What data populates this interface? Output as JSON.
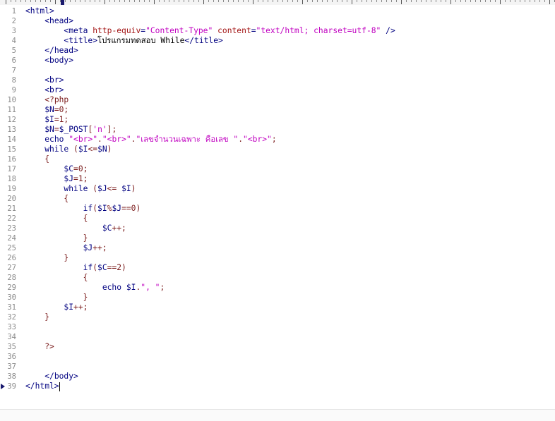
{
  "editor": {
    "lines": [
      {
        "n": "1",
        "segs": [
          {
            "c": "tag",
            "t": "<html>"
          }
        ]
      },
      {
        "n": "2",
        "segs": [
          {
            "c": "plain",
            "t": "    "
          },
          {
            "c": "tag",
            "t": "<head>"
          }
        ]
      },
      {
        "n": "3",
        "segs": [
          {
            "c": "plain",
            "t": "        "
          },
          {
            "c": "tag",
            "t": "<meta "
          },
          {
            "c": "attr",
            "t": "http-equiv"
          },
          {
            "c": "tag",
            "t": "="
          },
          {
            "c": "str",
            "t": "\"Content-Type\""
          },
          {
            "c": "tag",
            "t": " "
          },
          {
            "c": "attr",
            "t": "content"
          },
          {
            "c": "tag",
            "t": "="
          },
          {
            "c": "str",
            "t": "\"text/html; charset=utf-8\""
          },
          {
            "c": "tag",
            "t": " />"
          }
        ]
      },
      {
        "n": "4",
        "segs": [
          {
            "c": "plain",
            "t": "        "
          },
          {
            "c": "tag",
            "t": "<title>"
          },
          {
            "c": "plain",
            "t": "โปรแกรมทดสอบ While"
          },
          {
            "c": "tag",
            "t": "</title>"
          }
        ]
      },
      {
        "n": "5",
        "segs": [
          {
            "c": "plain",
            "t": "    "
          },
          {
            "c": "tag",
            "t": "</head>"
          }
        ]
      },
      {
        "n": "6",
        "segs": [
          {
            "c": "plain",
            "t": "    "
          },
          {
            "c": "tag",
            "t": "<body>"
          }
        ]
      },
      {
        "n": "7",
        "segs": []
      },
      {
        "n": "8",
        "segs": [
          {
            "c": "plain",
            "t": "    "
          },
          {
            "c": "tag",
            "t": "<br>"
          }
        ]
      },
      {
        "n": "9",
        "segs": [
          {
            "c": "plain",
            "t": "    "
          },
          {
            "c": "tag",
            "t": "<br>"
          }
        ]
      },
      {
        "n": "10",
        "segs": [
          {
            "c": "plain",
            "t": "    "
          },
          {
            "c": "php",
            "t": "<?php"
          }
        ]
      },
      {
        "n": "11",
        "segs": [
          {
            "c": "plain",
            "t": "    "
          },
          {
            "c": "var",
            "t": "$N"
          },
          {
            "c": "php",
            "t": "=0;"
          }
        ]
      },
      {
        "n": "12",
        "segs": [
          {
            "c": "plain",
            "t": "    "
          },
          {
            "c": "var",
            "t": "$I"
          },
          {
            "c": "php",
            "t": "=1;"
          }
        ]
      },
      {
        "n": "13",
        "segs": [
          {
            "c": "plain",
            "t": "    "
          },
          {
            "c": "var",
            "t": "$N"
          },
          {
            "c": "php",
            "t": "="
          },
          {
            "c": "var",
            "t": "$_POST"
          },
          {
            "c": "php",
            "t": "["
          },
          {
            "c": "str",
            "t": "'n'"
          },
          {
            "c": "php",
            "t": "];"
          }
        ]
      },
      {
        "n": "14",
        "segs": [
          {
            "c": "plain",
            "t": "    "
          },
          {
            "c": "kw",
            "t": "echo "
          },
          {
            "c": "str",
            "t": "\"<br>\""
          },
          {
            "c": "php",
            "t": "."
          },
          {
            "c": "str",
            "t": "\"<br>\""
          },
          {
            "c": "php",
            "t": "."
          },
          {
            "c": "str",
            "t": "\"เลขจำนวนเฉพาะ คือเลข \""
          },
          {
            "c": "php",
            "t": "."
          },
          {
            "c": "str",
            "t": "\"<br>\""
          },
          {
            "c": "php",
            "t": ";"
          }
        ]
      },
      {
        "n": "15",
        "segs": [
          {
            "c": "plain",
            "t": "    "
          },
          {
            "c": "kw",
            "t": "while "
          },
          {
            "c": "php",
            "t": "("
          },
          {
            "c": "var",
            "t": "$I"
          },
          {
            "c": "php",
            "t": "<="
          },
          {
            "c": "var",
            "t": "$N"
          },
          {
            "c": "php",
            "t": ")"
          }
        ]
      },
      {
        "n": "16",
        "segs": [
          {
            "c": "plain",
            "t": "    "
          },
          {
            "c": "php",
            "t": "{"
          }
        ]
      },
      {
        "n": "17",
        "segs": [
          {
            "c": "plain",
            "t": "        "
          },
          {
            "c": "var",
            "t": "$C"
          },
          {
            "c": "php",
            "t": "=0;"
          }
        ]
      },
      {
        "n": "18",
        "segs": [
          {
            "c": "plain",
            "t": "        "
          },
          {
            "c": "var",
            "t": "$J"
          },
          {
            "c": "php",
            "t": "=1;"
          }
        ]
      },
      {
        "n": "19",
        "segs": [
          {
            "c": "plain",
            "t": "        "
          },
          {
            "c": "kw",
            "t": "while "
          },
          {
            "c": "php",
            "t": "("
          },
          {
            "c": "var",
            "t": "$J"
          },
          {
            "c": "php",
            "t": "<= "
          },
          {
            "c": "var",
            "t": "$I"
          },
          {
            "c": "php",
            "t": ")"
          }
        ]
      },
      {
        "n": "20",
        "segs": [
          {
            "c": "plain",
            "t": "        "
          },
          {
            "c": "php",
            "t": "{"
          }
        ]
      },
      {
        "n": "21",
        "segs": [
          {
            "c": "plain",
            "t": "            "
          },
          {
            "c": "kw",
            "t": "if"
          },
          {
            "c": "php",
            "t": "("
          },
          {
            "c": "var",
            "t": "$I"
          },
          {
            "c": "php",
            "t": "%"
          },
          {
            "c": "var",
            "t": "$J"
          },
          {
            "c": "php",
            "t": "==0)"
          }
        ]
      },
      {
        "n": "22",
        "segs": [
          {
            "c": "plain",
            "t": "            "
          },
          {
            "c": "php",
            "t": "{"
          }
        ]
      },
      {
        "n": "23",
        "segs": [
          {
            "c": "plain",
            "t": "                "
          },
          {
            "c": "var",
            "t": "$C"
          },
          {
            "c": "php",
            "t": "++;"
          }
        ]
      },
      {
        "n": "24",
        "segs": [
          {
            "c": "plain",
            "t": "            "
          },
          {
            "c": "php",
            "t": "}"
          }
        ]
      },
      {
        "n": "25",
        "segs": [
          {
            "c": "plain",
            "t": "            "
          },
          {
            "c": "var",
            "t": "$J"
          },
          {
            "c": "php",
            "t": "++;"
          }
        ]
      },
      {
        "n": "26",
        "segs": [
          {
            "c": "plain",
            "t": "        "
          },
          {
            "c": "php",
            "t": "}"
          }
        ]
      },
      {
        "n": "27",
        "segs": [
          {
            "c": "plain",
            "t": "            "
          },
          {
            "c": "kw",
            "t": "if"
          },
          {
            "c": "php",
            "t": "("
          },
          {
            "c": "var",
            "t": "$C"
          },
          {
            "c": "php",
            "t": "==2)"
          }
        ]
      },
      {
        "n": "28",
        "segs": [
          {
            "c": "plain",
            "t": "            "
          },
          {
            "c": "php",
            "t": "{"
          }
        ]
      },
      {
        "n": "29",
        "segs": [
          {
            "c": "plain",
            "t": "                "
          },
          {
            "c": "kw",
            "t": "echo "
          },
          {
            "c": "var",
            "t": "$I"
          },
          {
            "c": "php",
            "t": "."
          },
          {
            "c": "str",
            "t": "\", \""
          },
          {
            "c": "php",
            "t": ";"
          }
        ]
      },
      {
        "n": "30",
        "segs": [
          {
            "c": "plain",
            "t": "            "
          },
          {
            "c": "php",
            "t": "}"
          }
        ]
      },
      {
        "n": "31",
        "segs": [
          {
            "c": "plain",
            "t": "        "
          },
          {
            "c": "var",
            "t": "$I"
          },
          {
            "c": "php",
            "t": "++;"
          }
        ]
      },
      {
        "n": "32",
        "segs": [
          {
            "c": "plain",
            "t": "    "
          },
          {
            "c": "php",
            "t": "}"
          }
        ]
      },
      {
        "n": "33",
        "segs": []
      },
      {
        "n": "34",
        "segs": []
      },
      {
        "n": "35",
        "segs": [
          {
            "c": "plain",
            "t": "    "
          },
          {
            "c": "php",
            "t": "?>"
          }
        ]
      },
      {
        "n": "36",
        "segs": []
      },
      {
        "n": "37",
        "segs": []
      },
      {
        "n": "38",
        "segs": [
          {
            "c": "plain",
            "t": "    "
          },
          {
            "c": "tag",
            "t": "</body>"
          }
        ]
      },
      {
        "n": "39",
        "segs": [
          {
            "c": "tag",
            "t": "</html>"
          }
        ],
        "current": true
      }
    ]
  },
  "colors": {
    "tag": "#000080",
    "attribute": "#a31515",
    "string": "#c000c0",
    "php": "#7a1a1a",
    "line_number": "#8a8a8a",
    "current_line_marker": "#1a1a6e"
  },
  "icons": {
    "current_line_marker": "triangle-right-icon",
    "ruler_caret": "caret-marker-icon"
  }
}
